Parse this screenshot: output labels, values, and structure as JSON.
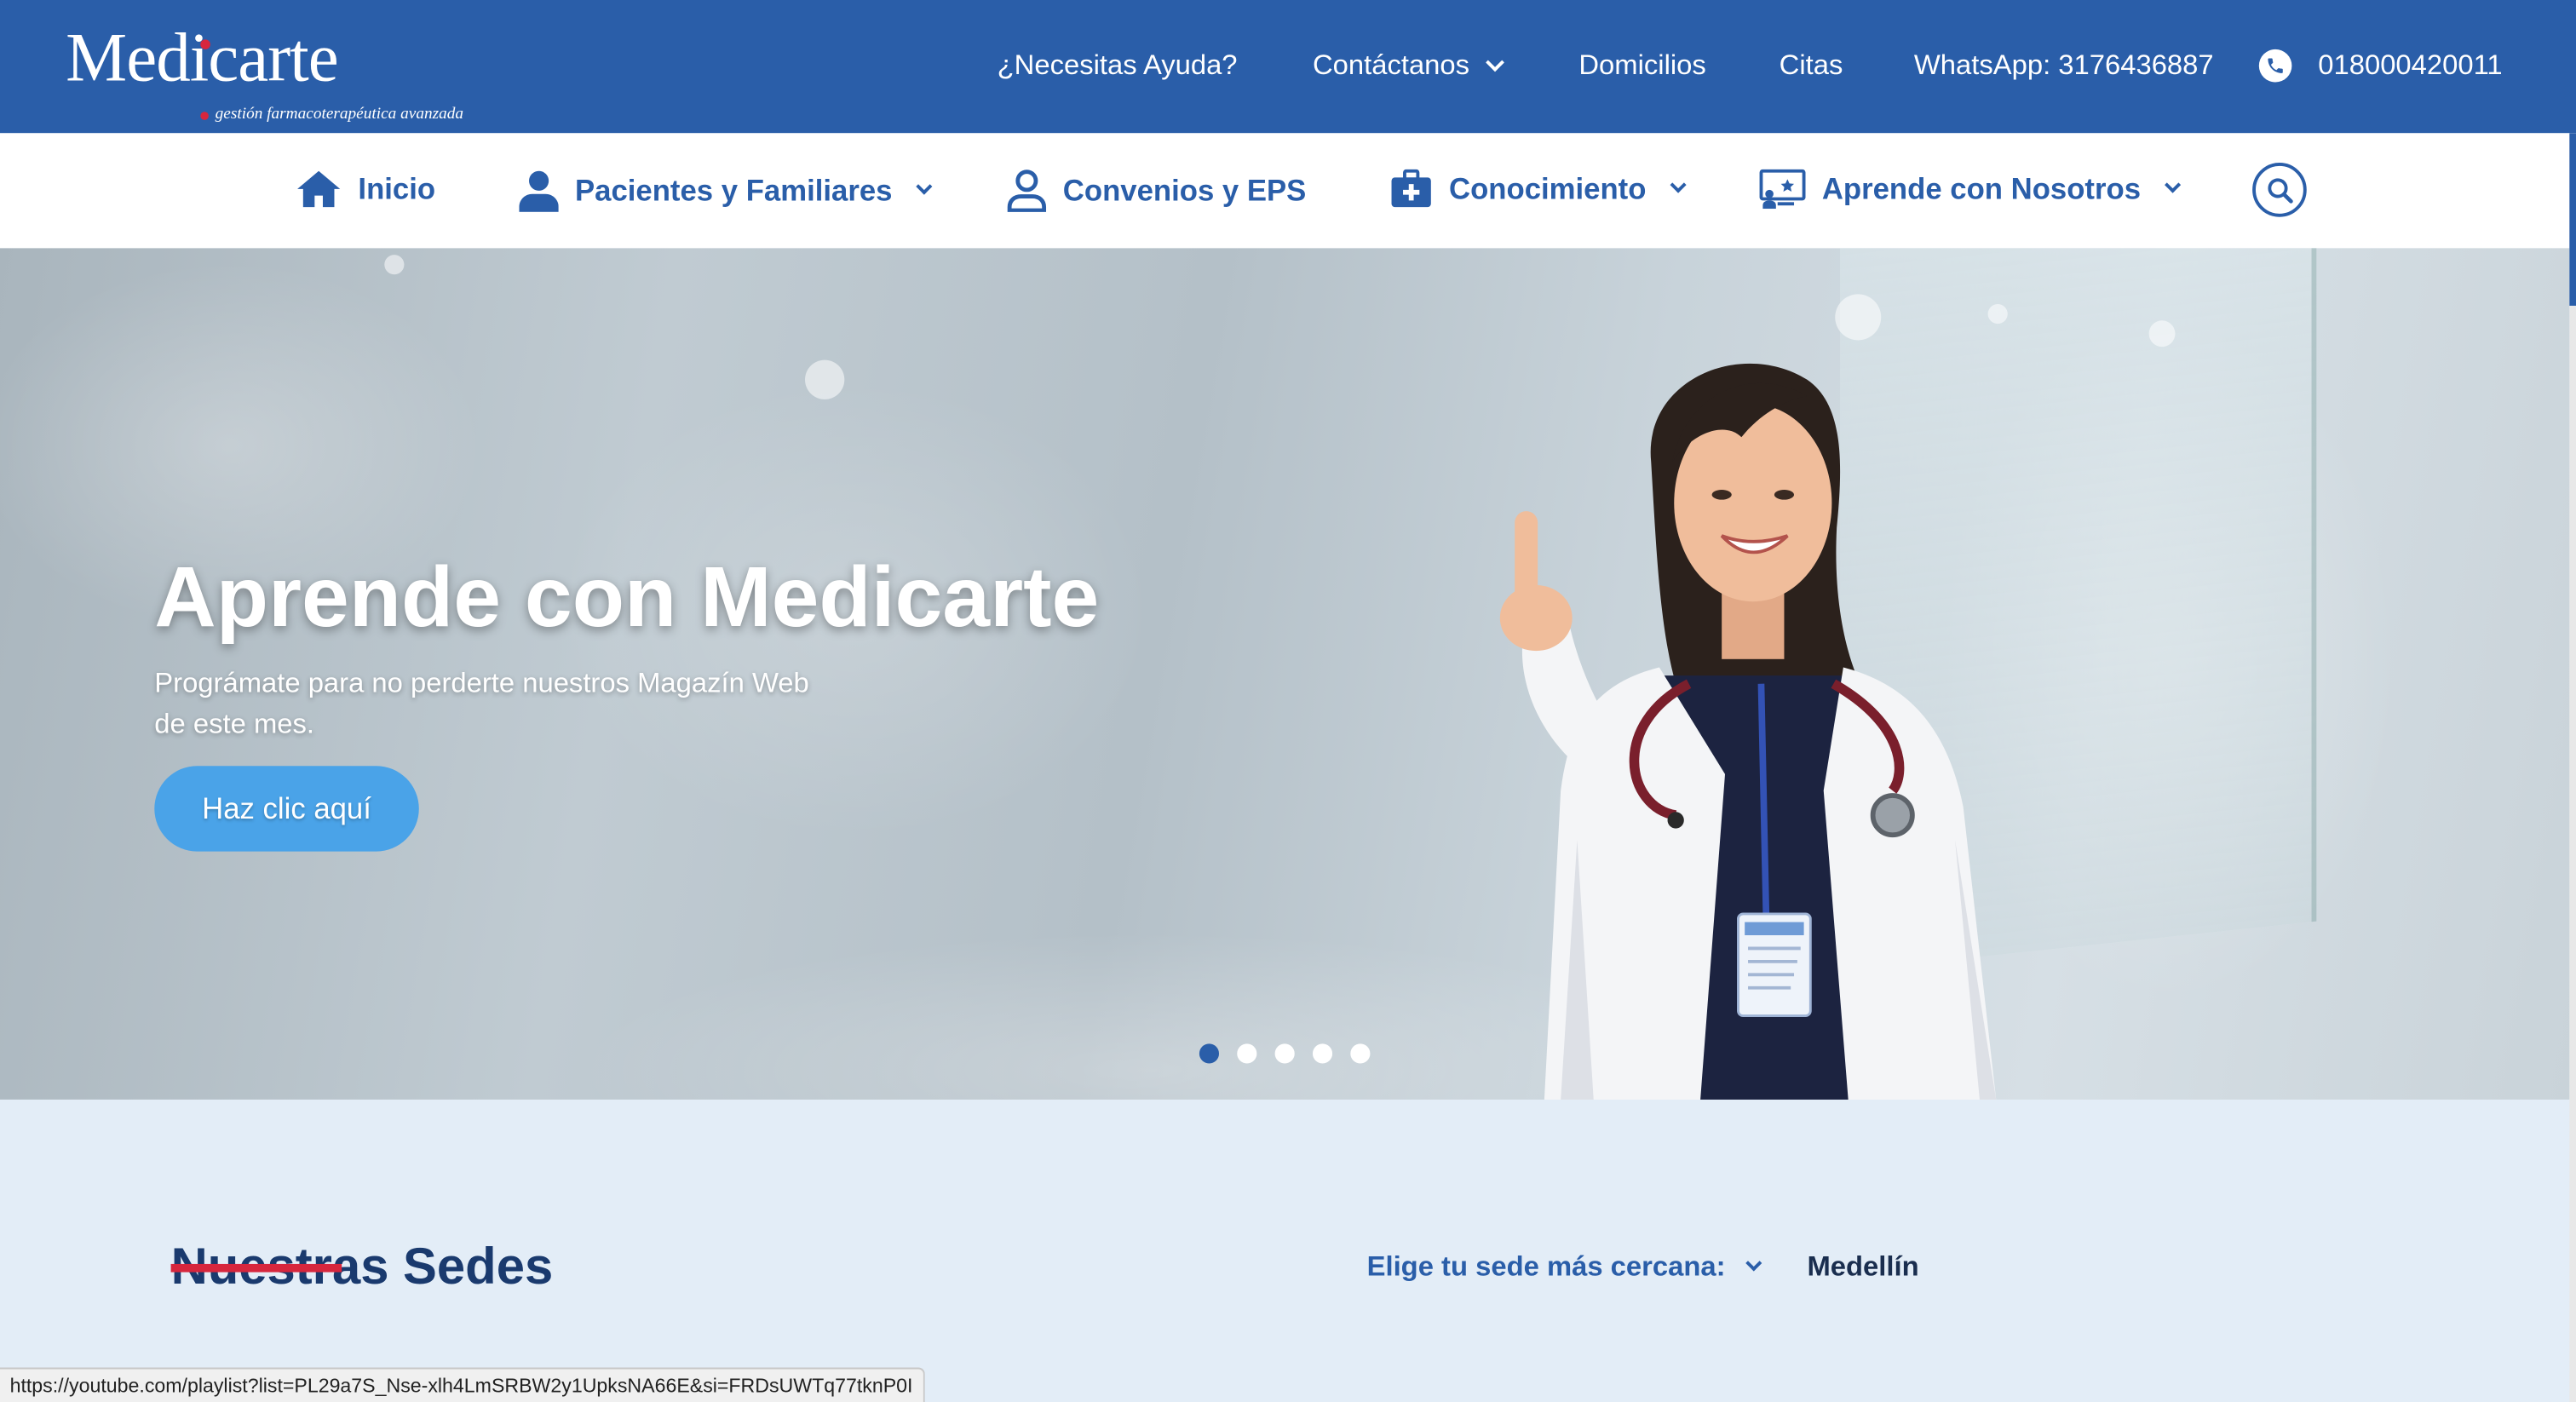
{
  "brand": {
    "name": "Medicarte",
    "tagline": "gestión farmacoterapéutica avanzada",
    "primary_color": "#2a5ea9",
    "accent_color": "#d7263d",
    "button_color": "#4aa3e8"
  },
  "topbar": {
    "help": "¿Necesitas Ayuda?",
    "contact": "Contáctanos",
    "delivery": "Domicilios",
    "appointments": "Citas",
    "whatsapp": "WhatsApp: 3176436887",
    "phone": "018000420011"
  },
  "mainnav": {
    "items": [
      {
        "label": "Inicio",
        "icon": "home-icon"
      },
      {
        "label": "Pacientes y Familiares",
        "icon": "user-icon"
      },
      {
        "label": "Convenios y EPS",
        "icon": "user-outline-icon"
      },
      {
        "label": "Conocimiento",
        "icon": "medical-kit-icon"
      },
      {
        "label": "Aprende con Nosotros",
        "icon": "presentation-icon"
      }
    ],
    "search_icon": "search-icon"
  },
  "hero": {
    "title": "Aprende con Medicarte",
    "subtitle": "Prográmate para no perderte nuestros Magazín Web de este mes.",
    "button": "Haz clic aquí",
    "slides": 5,
    "active_slide": 1
  },
  "sedes": {
    "title": "Nuestras Sedes",
    "select_label": "Elige tu sede más cercana:",
    "selected": "Medellín"
  },
  "statusbar": {
    "url": "https://youtube.com/playlist?list=PL29a7S_Nse-xlh4LmSRBW2y1UpksNA66E&si=FRDsUWTq77tknP0I"
  }
}
